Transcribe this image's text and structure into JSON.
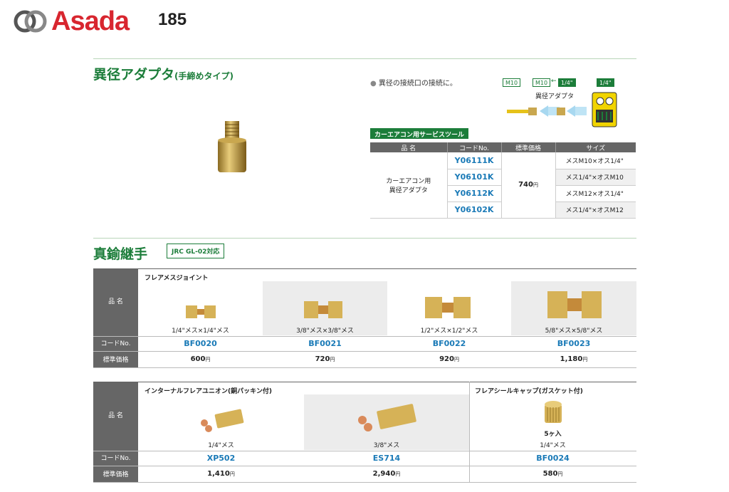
{
  "header": {
    "brand": "Asada",
    "page_number": "185"
  },
  "section1": {
    "title": "異径アダプタ",
    "title_sub": "(手締めタイプ)",
    "bullet": "異径の接続口の接続に。",
    "diagram": {
      "tag1": "M10",
      "tag2": "M10",
      "tag3": "1/4\"",
      "tag4": "1/4\"",
      "arrow": "←",
      "label": "異径アダプタ"
    },
    "tool_label": "カーエアコン用サービスツール",
    "table": {
      "headers": [
        "品 名",
        "コードNo.",
        "標準価格",
        "サイズ"
      ],
      "name_line1": "カーエアコン用",
      "name_line2": "異径アダプタ",
      "price": "740",
      "yen": "円",
      "rows": [
        {
          "code": "Y06111K",
          "size": "メスM10×オス1/4\""
        },
        {
          "code": "Y06101K",
          "size": "メス1/4\"×オスM10"
        },
        {
          "code": "Y06112K",
          "size": "メスM12×オス1/4\""
        },
        {
          "code": "Y06102K",
          "size": "メス1/4\"×オスM12"
        }
      ]
    }
  },
  "section2": {
    "title": "真鍮継手",
    "badge": "JRC GL-02対応",
    "side_name": "品 名",
    "side_code": "コードNo.",
    "side_price": "標準価格",
    "grid1": {
      "category": "フレアメスジョイント",
      "items": [
        {
          "label": "1/4\"メス×1/4\"メス",
          "code": "BF0020",
          "price": "600"
        },
        {
          "label": "3/8\"メス×3/8\"メス",
          "code": "BF0021",
          "price": "720"
        },
        {
          "label": "1/2\"メス×1/2\"メス",
          "code": "BF0022",
          "price": "920"
        },
        {
          "label": "5/8\"メス×5/8\"メス",
          "code": "BF0023",
          "price": "1,180"
        }
      ]
    },
    "grid2": {
      "category1": "インターナルフレアユニオン(銅パッキン付)",
      "category2": "フレアシールキャップ(ガスケット付)",
      "items": [
        {
          "label": "1/4\"メス",
          "code": "XP502",
          "price": "1,410"
        },
        {
          "label": "3/8\"メス",
          "code": "ES714",
          "price": "2,940"
        },
        {
          "label": "1/4\"メス",
          "code": "BF0024",
          "price": "580",
          "note": "5ヶ入"
        }
      ]
    },
    "yen": "円"
  },
  "colors": {
    "brand_red": "#d8262f",
    "accent_green": "#1c7d3a",
    "code_blue": "#1a7ab7"
  }
}
